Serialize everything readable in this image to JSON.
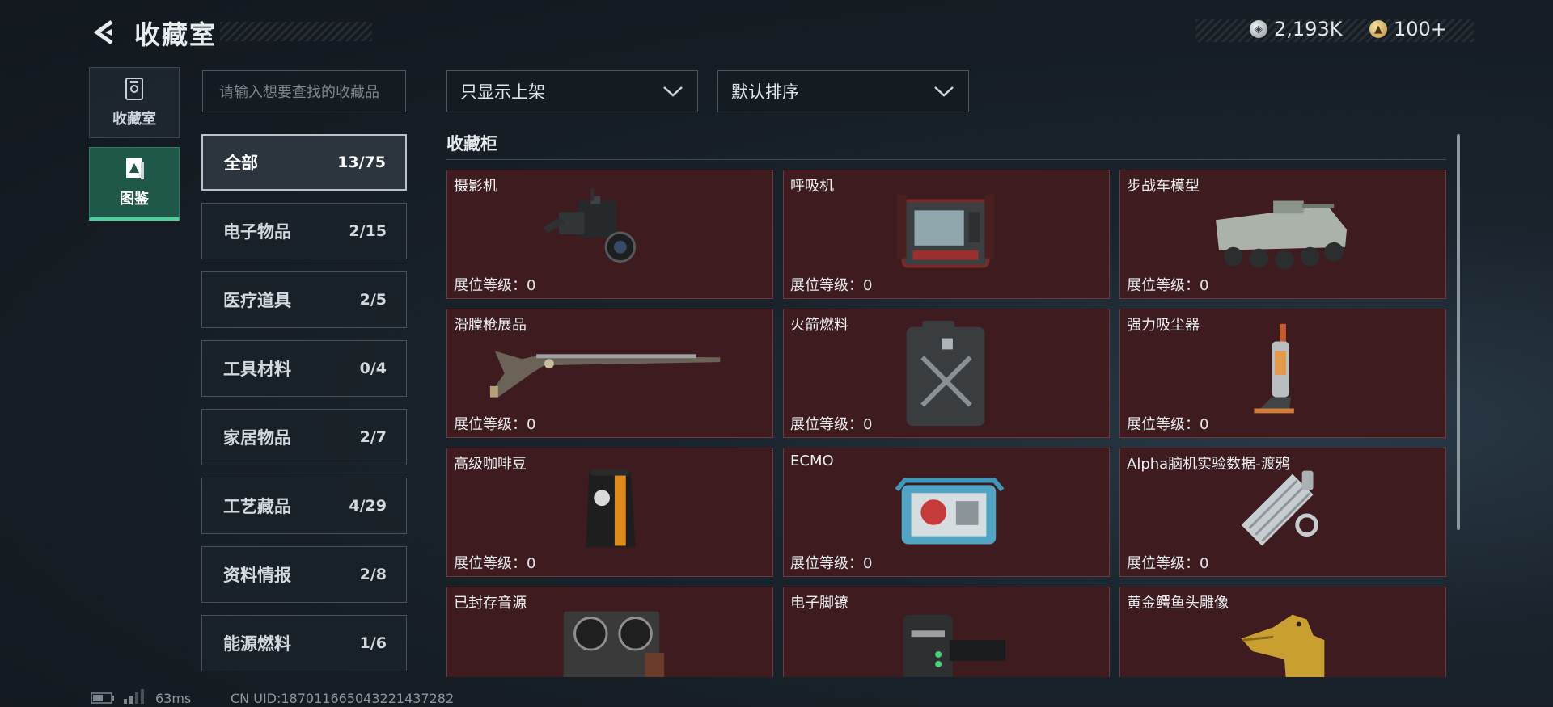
{
  "header": {
    "title": "收藏室"
  },
  "currency": [
    {
      "icon": "silver-coin-icon",
      "value": "2,193K"
    },
    {
      "icon": "gold-coin-icon",
      "value": "100+"
    }
  ],
  "side_nav": [
    {
      "label": "收藏室",
      "icon": "collection-room-icon",
      "active": false
    },
    {
      "label": "图鉴",
      "icon": "catalog-icon",
      "active": true
    }
  ],
  "search": {
    "placeholder": "请输入想要查找的收藏品",
    "value": ""
  },
  "filters": {
    "display": "只显示上架",
    "sort": "默认排序"
  },
  "categories": [
    {
      "name": "全部",
      "count": "13/75",
      "active": true
    },
    {
      "name": "电子物品",
      "count": "2/15"
    },
    {
      "name": "医疗道具",
      "count": "2/5"
    },
    {
      "name": "工具材料",
      "count": "0/4"
    },
    {
      "name": "家居物品",
      "count": "2/7"
    },
    {
      "name": "工艺藏品",
      "count": "4/29"
    },
    {
      "name": "资料情报",
      "count": "2/8"
    },
    {
      "name": "能源燃料",
      "count": "1/6"
    }
  ],
  "cabinet": {
    "title": "收藏柜",
    "items": [
      {
        "name": "摄影机",
        "level": "展位等级：0",
        "icon": "camera-icon"
      },
      {
        "name": "呼吸机",
        "level": "展位等级：0",
        "icon": "ventilator-icon"
      },
      {
        "name": "步战车模型",
        "level": "展位等级：0",
        "icon": "ifv-model-icon"
      },
      {
        "name": "滑膛枪展品",
        "level": "展位等级：0",
        "icon": "musket-icon"
      },
      {
        "name": "火箭燃料",
        "level": "展位等级：0",
        "icon": "fuel-can-icon"
      },
      {
        "name": "强力吸尘器",
        "level": "展位等级：0",
        "icon": "vacuum-icon"
      },
      {
        "name": "高级咖啡豆",
        "level": "展位等级：0",
        "icon": "coffee-bag-icon"
      },
      {
        "name": "ECMO",
        "level": "展位等级：0",
        "icon": "ecmo-icon"
      },
      {
        "name": "Alpha脑机实验数据-渡鸦",
        "level": "展位等级：0",
        "icon": "data-drive-icon"
      },
      {
        "name": "已封存音源",
        "level": "",
        "icon": "tape-recorder-icon"
      },
      {
        "name": "电子脚镣",
        "level": "",
        "icon": "ankle-monitor-icon"
      },
      {
        "name": "黄金鳄鱼头雕像",
        "level": "",
        "icon": "gold-croc-statue-icon"
      }
    ]
  },
  "status_bar": {
    "ping": "63ms",
    "uid": "CN UID:18701166504322143728​2"
  },
  "colors": {
    "accent_green": "#46d39a",
    "card_bg": "#3d1b1f",
    "card_border": "#6a3a3f"
  }
}
